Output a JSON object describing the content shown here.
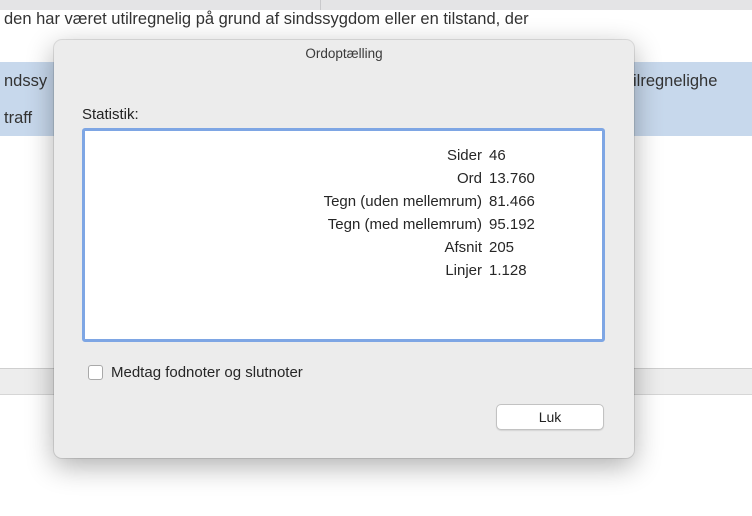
{
  "document": {
    "lines": [
      "den har været utilregnelig på grund af sindssygdom eller en tilstand, der",
      "ndssy",
      "traff"
    ],
    "right_fragment": "ilregnelighe"
  },
  "dialog": {
    "title": "Ordoptælling",
    "section_label": "Statistik:",
    "stats": [
      {
        "label": "Sider",
        "value": "46"
      },
      {
        "label": "Ord",
        "value": "13.760"
      },
      {
        "label": "Tegn (uden mellemrum)",
        "value": "81.466"
      },
      {
        "label": "Tegn (med mellemrum)",
        "value": "95.192"
      },
      {
        "label": "Afsnit",
        "value": "205"
      },
      {
        "label": "Linjer",
        "value": "1.128"
      }
    ],
    "checkbox": {
      "label": "Medtag fodnoter og slutnoter",
      "checked": false
    },
    "close_button": "Luk"
  },
  "colors": {
    "focus_ring": "#7ea6e4",
    "selection": "#c7d8ec"
  }
}
